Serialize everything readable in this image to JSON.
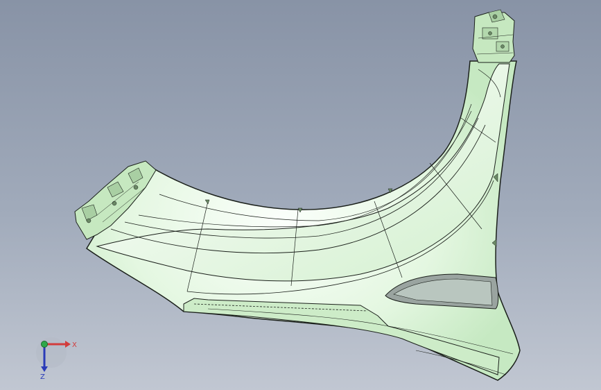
{
  "viewport": {
    "background_top": "#8893a6",
    "background_bottom": "#c1c7d2"
  },
  "part": {
    "fill_color": "#d9f3d6",
    "highlight_color": "#fbfffb",
    "edge_color": "#1a1f1a"
  },
  "triad": {
    "x_label": "X",
    "z_label": "Z",
    "x_color": "#d23c3c",
    "y_color": "#2ea84a",
    "z_color": "#2a3bb8"
  }
}
